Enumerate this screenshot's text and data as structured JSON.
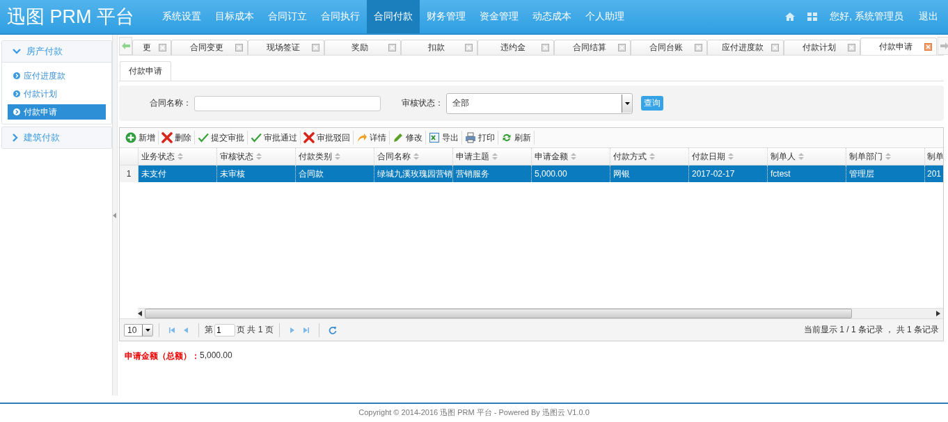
{
  "header": {
    "logo": "迅图 PRM 平台",
    "nav": [
      {
        "label": "系统设置",
        "selected": false
      },
      {
        "label": "目标成本",
        "selected": false
      },
      {
        "label": "合同订立",
        "selected": false
      },
      {
        "label": "合同执行",
        "selected": false
      },
      {
        "label": "合同付款",
        "selected": true
      },
      {
        "label": "财务管理",
        "selected": false
      },
      {
        "label": "资金管理",
        "selected": false
      },
      {
        "label": "动态成本",
        "selected": false
      },
      {
        "label": "个人助理",
        "selected": false
      }
    ],
    "greeting": "您好, 系统管理员",
    "logout": "退出"
  },
  "sidebar": [
    {
      "label": "房产付款",
      "expanded": true,
      "items": [
        {
          "label": "应付进度款",
          "selected": false
        },
        {
          "label": "付款计划",
          "selected": false
        },
        {
          "label": "付款申请",
          "selected": true
        }
      ]
    },
    {
      "label": "建筑付款",
      "expanded": false
    }
  ],
  "tabs": [
    {
      "label": "更",
      "selected": false
    },
    {
      "label": "合同变更",
      "selected": false
    },
    {
      "label": "现场签证",
      "selected": false
    },
    {
      "label": "奖励",
      "selected": false
    },
    {
      "label": "扣款",
      "selected": false
    },
    {
      "label": "违约金",
      "selected": false
    },
    {
      "label": "合同结算",
      "selected": false
    },
    {
      "label": "合同台账",
      "selected": false
    },
    {
      "label": "应付进度款",
      "selected": false
    },
    {
      "label": "付款计划",
      "selected": false
    },
    {
      "label": "付款申请",
      "selected": true
    }
  ],
  "subtab": "付款申请",
  "search": {
    "name_label": "合同名称：",
    "status_label": "审核状态：",
    "status_value": "全部",
    "query": "查询"
  },
  "toolbar": [
    {
      "kind": "add",
      "label": "新增"
    },
    {
      "kind": "delete",
      "label": "删除"
    },
    {
      "kind": "check",
      "label": "提交审批"
    },
    {
      "kind": "check",
      "label": "审批通过"
    },
    {
      "kind": "delete",
      "label": "审批驳回"
    },
    {
      "kind": "forward",
      "label": "详情"
    },
    {
      "kind": "edit",
      "label": "修改"
    },
    {
      "kind": "export",
      "label": "导出"
    },
    {
      "kind": "print",
      "label": "打印"
    },
    {
      "kind": "refresh",
      "label": "刷新"
    }
  ],
  "table": {
    "columns": [
      "业务状态",
      "审核状态",
      "付款类别",
      "合同名称",
      "申请主题",
      "申请金额",
      "付款方式",
      "付款日期",
      "制单人",
      "制单部门",
      "制单"
    ],
    "rows": [
      {
        "number": "1",
        "selected": true,
        "cells": [
          "未支付",
          "未审核",
          "合同款",
          "绿城九溪玫瑰园营销",
          "营销服务",
          "5,000.00",
          "网银",
          "2017-02-17",
          "fctest",
          "管理层",
          "201"
        ]
      }
    ]
  },
  "pager": {
    "page_size": "10",
    "page_prefix": "第",
    "page": "1",
    "page_suffix": "页 共 1 页",
    "summary": "当前显示 1 / 1 条记录 ， 共 1 条记录"
  },
  "total": {
    "label": "申请金额（总额）：",
    "value": "5,000.00"
  },
  "footer": "Copyright © 2014-2016 迅图 PRM 平台 - Powered By 迅图云 V1.0.0"
}
